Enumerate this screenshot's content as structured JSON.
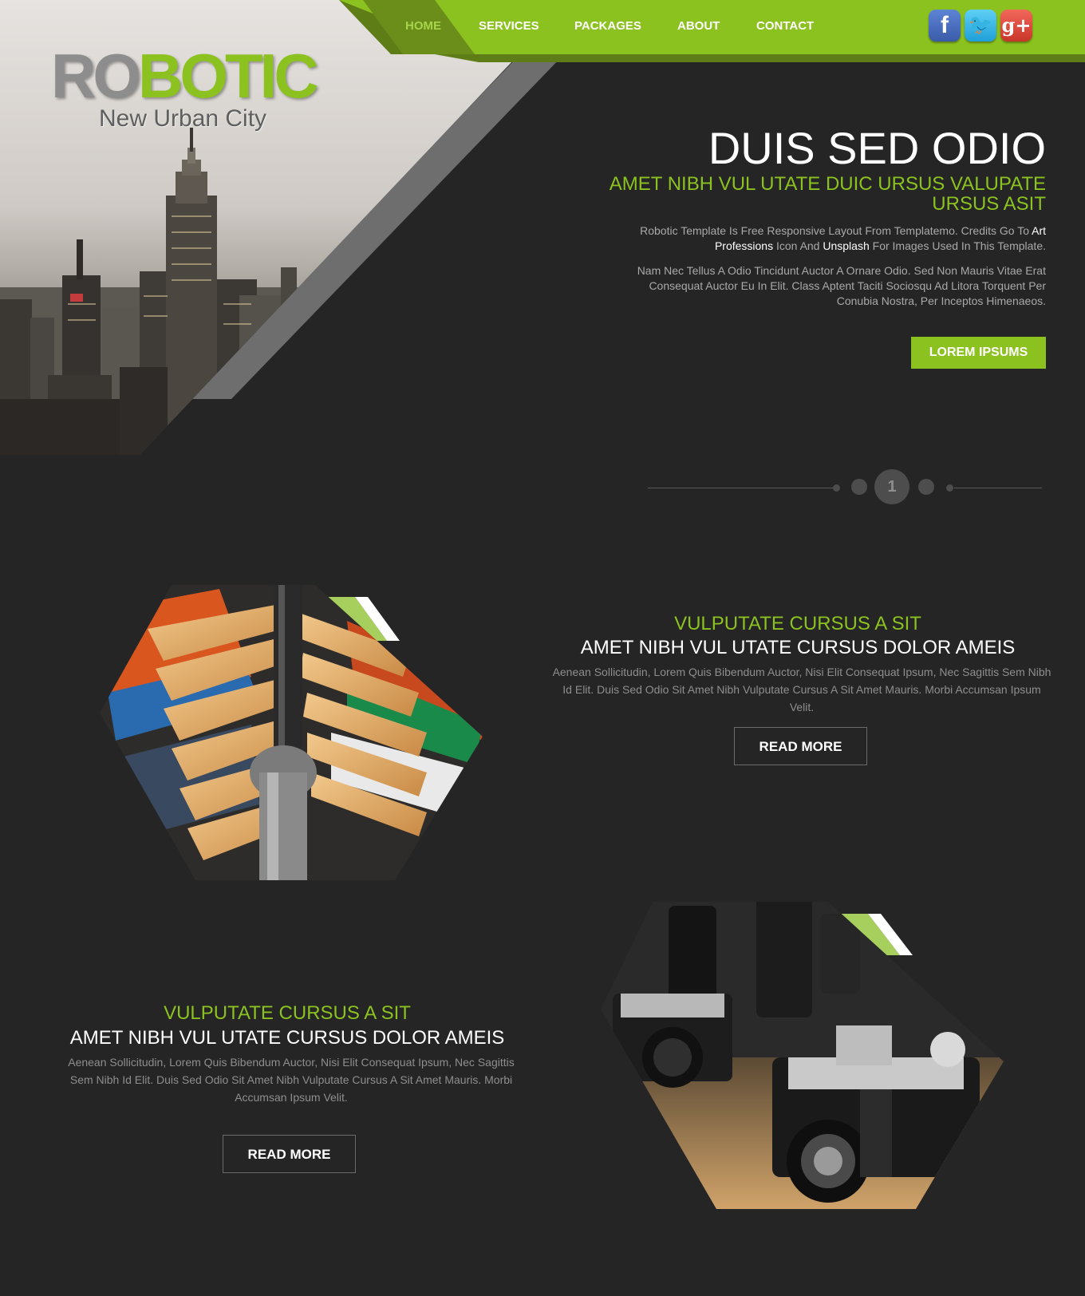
{
  "brand": {
    "logo_part1": "RO",
    "logo_part2": "BOTIC",
    "tagline": "New Urban City"
  },
  "nav": {
    "items": [
      {
        "label": "HOME",
        "active": true
      },
      {
        "label": "SERVICES"
      },
      {
        "label": "PACKAGES"
      },
      {
        "label": "ABOUT"
      },
      {
        "label": "CONTACT"
      }
    ]
  },
  "social": {
    "facebook": {
      "glyph": "f",
      "icon": "facebook-icon"
    },
    "twitter": {
      "glyph": "🐦",
      "icon": "twitter-icon"
    },
    "googleplus": {
      "glyph": "g+",
      "icon": "google-plus-icon"
    }
  },
  "hero": {
    "title": "DUIS SED ODIO",
    "subtitle": "AMET NIBH VUL UTATE DUIC URSUS VALUPATE URSUS ASIT",
    "p1_a": "Robotic Template Is Free Responsive Layout From Templatemo. Credits Go To ",
    "p1_link1": "Art Professions",
    "p1_b": " Icon And ",
    "p1_link2": "Unsplash",
    "p1_c": " For Images Used In This Template.",
    "p2": "Nam Nec Tellus A Odio Tincidunt Auctor A Ornare Odio. Sed Non Mauris Vitae Erat Consequat Auctor Eu In Elit. Class Aptent Taciti Sociosqu Ad Litora Torquent Per Conubia Nostra, Per Inceptos Himenaeos.",
    "button": "LOREM IPSUMS"
  },
  "slider": {
    "current": "1"
  },
  "features": [
    {
      "kicker": "VULPUTATE CURSUS A SIT",
      "title": "AMET NIBH VUL UTATE CURSUS DOLOR AMEIS",
      "text": "Aenean Sollicitudin, Lorem Quis Bibendum Auctor, Nisi Elit Consequat Ipsum, Nec Sagittis Sem Nibh Id Elit. Duis Sed Odio Sit Amet Nibh Vulputate Cursus A Sit Amet Mauris. Morbi Accumsan Ipsum Velit.",
      "button": "READ MORE",
      "image": "clothes-hangers"
    },
    {
      "kicker": "VULPUTATE CURSUS A SIT",
      "title": "AMET NIBH VUL UTATE CURSUS DOLOR AMEIS",
      "text": "Aenean Sollicitudin, Lorem Quis Bibendum Auctor, Nisi Elit Consequat Ipsum, Nec Sagittis Sem Nibh Id Elit. Duis Sed Odio Sit Amet Nibh Vulputate Cursus A Sit Amet Mauris. Morbi Accumsan Ipsum Velit.",
      "button": "READ MORE",
      "image": "vintage-cameras"
    }
  ],
  "colors": {
    "accent": "#8cc21f",
    "background": "#252525",
    "nav_dark": "#6b8e1a"
  }
}
